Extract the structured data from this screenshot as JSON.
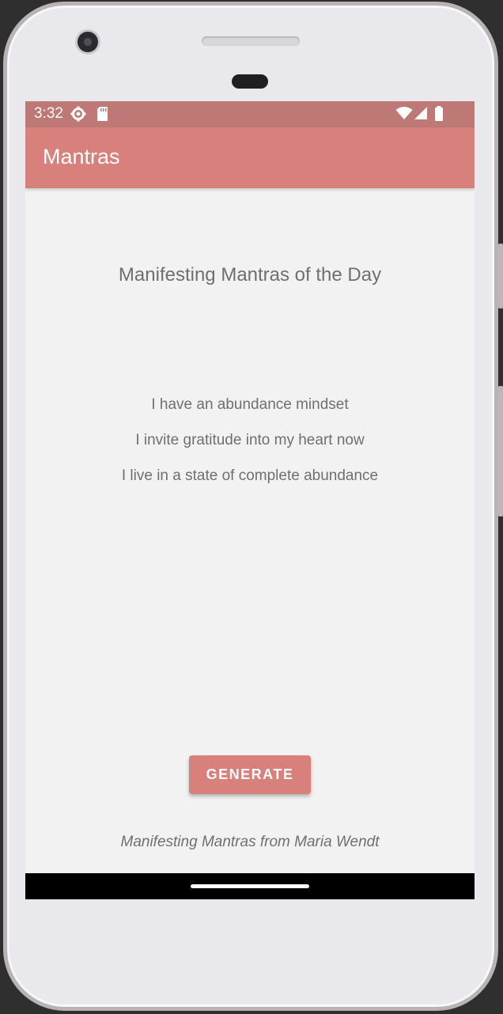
{
  "status_bar": {
    "time": "3:32",
    "left_icons": [
      "settings-icon",
      "sd-card-icon"
    ],
    "right_icons": [
      "wifi-icon",
      "signal-icon",
      "battery-icon"
    ]
  },
  "app_bar": {
    "title": "Mantras"
  },
  "main": {
    "heading": "Manifesting Mantras of the Day",
    "mantras": [
      "I have an abundance mindset",
      "I invite gratitude into my heart now",
      "I live in a state of complete abundance"
    ],
    "generate_button_label": "GENERATE",
    "footer_credit": "Manifesting Mantras from Maria Wendt"
  },
  "colors": {
    "status_bar": "#be7875",
    "app_bar": "#d8807c",
    "button": "#d8807c",
    "background": "#f2f2f2",
    "text": "#6f6f6f"
  }
}
